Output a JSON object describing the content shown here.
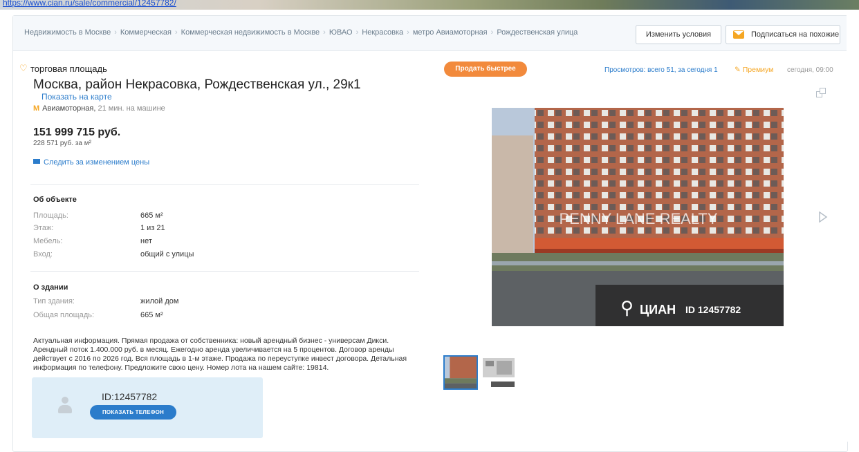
{
  "top_link": {
    "text": "https://www.cian.ru/sale/commercial/12457782/"
  },
  "breadcrumbs": [
    "Недвижимость в Москве",
    "Коммерческая",
    "Коммерческая недвижимость в Москве",
    "ЮВАО",
    "Некрасовка",
    "метро Авиамоторная",
    "Рождественская улица"
  ],
  "header_buttons": {
    "change": "Изменить условия",
    "subscribe": "Подписаться на похожие"
  },
  "listing": {
    "type": "торговая площадь",
    "title": "Москва, район Некрасовка, Рождественская ул., 29к1",
    "map_link": "Показать на карте",
    "metro_station": "Авиамоторная,",
    "metro_time": "21 мин. на машине",
    "price": "151 999 715 руб.",
    "price_per_m2": "228 571 руб. за м²",
    "follow_price": "Следить за изменением цены"
  },
  "about_object": {
    "heading": "Об объекте",
    "rows": [
      {
        "label": "Площадь:",
        "value": "665 м²"
      },
      {
        "label": "Этаж:",
        "value": "1 из 21"
      },
      {
        "label": "Мебель:",
        "value": "нет"
      },
      {
        "label": "Вход:",
        "value": "общий с улицы"
      }
    ]
  },
  "about_building": {
    "heading": "О здании",
    "rows": [
      {
        "label": "Тип здания:",
        "value": "жилой дом"
      },
      {
        "label": "Общая площадь:",
        "value": "665 м²"
      }
    ]
  },
  "description": "Актуальная информация. Прямая продажа от собственника: новый арендный бизнес - универсам Дикси. Арендный поток 1.400.000 руб. в месяц. Ежегодно аренда увеличивается на 5 процентов. Договор аренды действует с 2016 по 2026 год. Вся площадь в 1-м этаже. Продажа по переуступке инвест договора. Детальная информация по телефону. Предложите свою цену. Номер лота на нашем сайте: 19814.",
  "agent": {
    "id": "ID:12457782",
    "phone_button": "ПОКАЗАТЬ ТЕЛЕФОН"
  },
  "right_header": {
    "sell_button": "Продать быстрее",
    "views": "Просмотров: всего 51, за сегодня 1",
    "premium": "Премиум",
    "date": "сегодня, 09:00"
  },
  "photo": {
    "watermark_center": "PENNY LANE REALTY",
    "watermark_brand": "ЦИАН",
    "watermark_id": "ID 12457782"
  },
  "colors": {
    "accent_blue": "#2b7ccb",
    "accent_orange": "#f28a3c",
    "premium_orange": "#f5a623"
  }
}
